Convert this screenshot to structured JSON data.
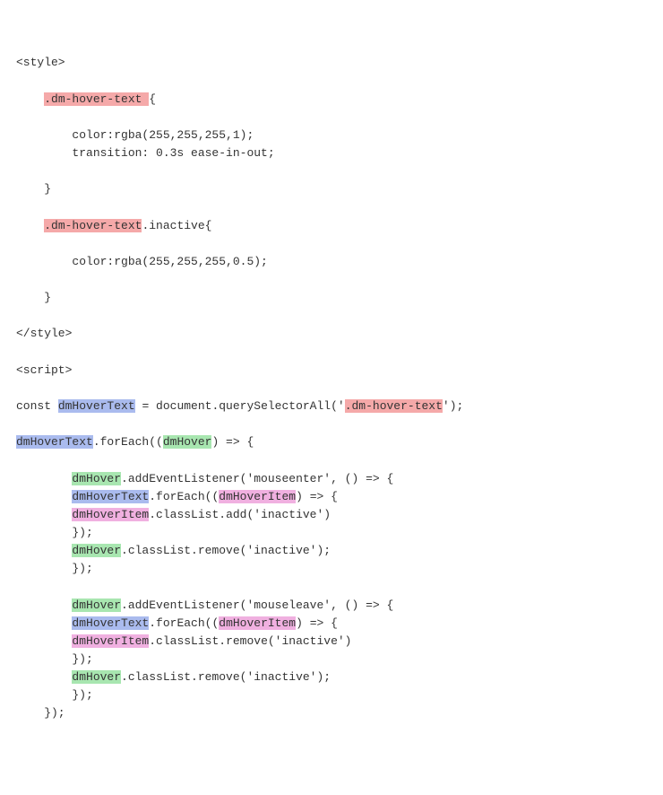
{
  "code": {
    "l1": "<style>",
    "l2a": "    ",
    "l2b": ".dm-hover-text ",
    "l2c": "{",
    "l3": "        color:rgba(255,255,255,1);",
    "l4": "        transition: 0.3s ease-in-out;",
    "l5": "    }",
    "l6a": "    ",
    "l6b": ".dm-hover-text",
    "l6c": ".inactive{",
    "l7": "        color:rgba(255,255,255,0.5);",
    "l8": "    }",
    "l9": "</style>",
    "l10": "<script>",
    "l11a": "const ",
    "l11b": "dmHoverText",
    "l11c": " = document.querySelectorAll('",
    "l11d": ".dm-hover-text",
    "l11e": "');",
    "l12a": "dmHoverText",
    "l12b": ".forEach((",
    "l12c": "dmHover",
    "l12d": ") => {",
    "l13a": "        ",
    "l13b": "dmHover",
    "l13c": ".addEventListener('mouseenter', () => {",
    "l14a": "        ",
    "l14b": "dmHoverText",
    "l14c": ".forEach((",
    "l14d": "dmHoverItem",
    "l14e": ") => {",
    "l15a": "        ",
    "l15b": "dmHoverItem",
    "l15c": ".classList.add('inactive')",
    "l16": "        });",
    "l17a": "        ",
    "l17b": "dmHover",
    "l17c": ".classList.remove('inactive');",
    "l18": "        });",
    "l19a": "        ",
    "l19b": "dmHover",
    "l19c": ".addEventListener('mouseleave', () => {",
    "l20a": "        ",
    "l20b": "dmHoverText",
    "l20c": ".forEach((",
    "l20d": "dmHoverItem",
    "l20e": ") => {",
    "l21a": "        ",
    "l21b": "dmHoverItem",
    "l21c": ".classList.remove('inactive')",
    "l22": "        });",
    "l23a": "        ",
    "l23b": "dmHover",
    "l23c": ".classList.remove('inactive');",
    "l24": "        });",
    "l25": "    });",
    "highlights": {
      "red": ".dm-hover-text",
      "blue": "dmHoverText",
      "green": "dmHover",
      "pink": "dmHoverItem"
    }
  }
}
